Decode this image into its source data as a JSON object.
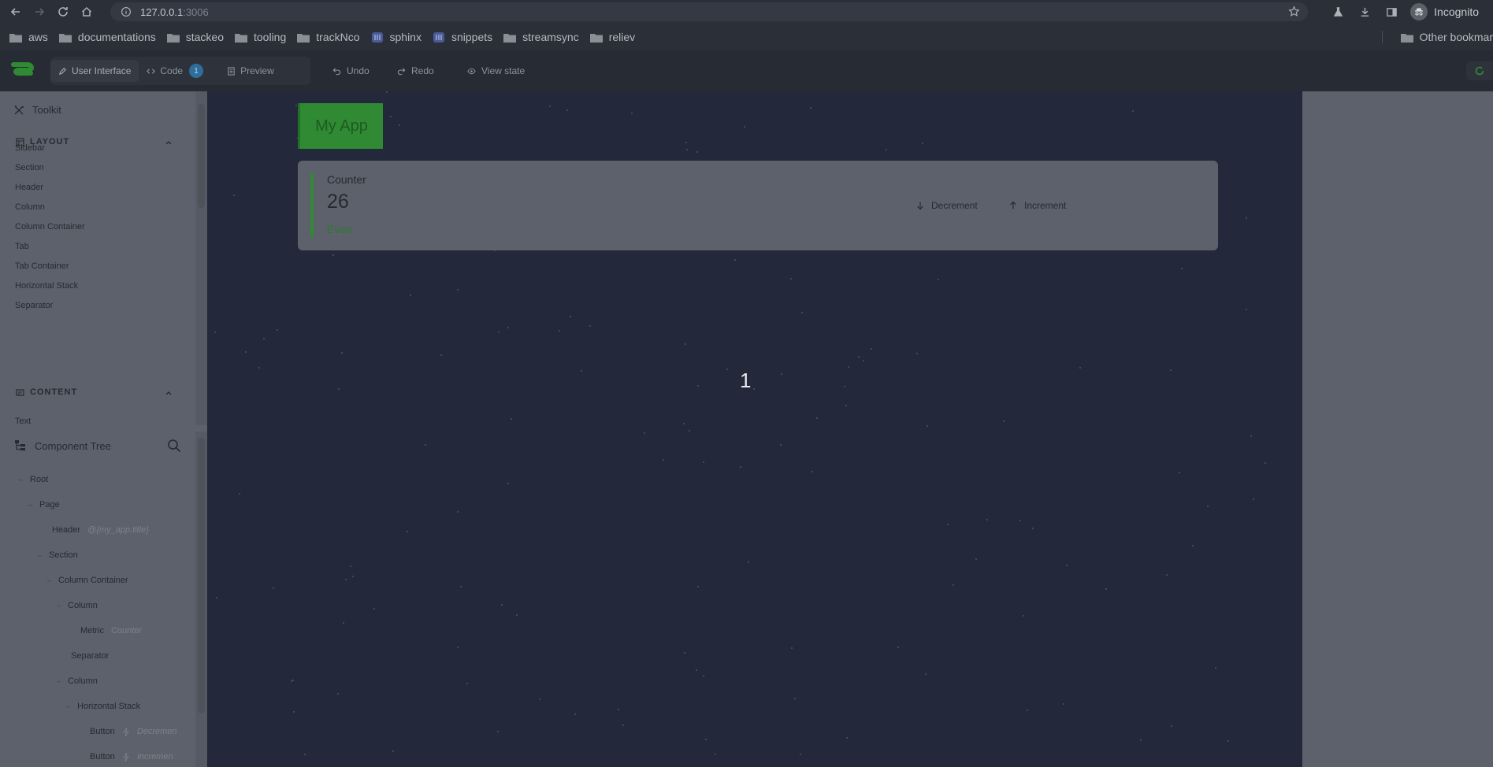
{
  "browser": {
    "url_host": "127.0.0.1",
    "url_port": ":3006",
    "profile_label": "Incognito",
    "bookmarks": [
      {
        "label": "aws",
        "kind": "folder"
      },
      {
        "label": "documentations",
        "kind": "folder"
      },
      {
        "label": "stackeo",
        "kind": "folder"
      },
      {
        "label": "tooling",
        "kind": "folder"
      },
      {
        "label": "trackNco",
        "kind": "folder"
      },
      {
        "label": "sphinx",
        "kind": "site"
      },
      {
        "label": "snippets",
        "kind": "site"
      },
      {
        "label": "streamsync",
        "kind": "folder"
      },
      {
        "label": "reliev",
        "kind": "folder"
      }
    ],
    "other_bookmarks": "Other bookmar"
  },
  "toolbar": {
    "ui_tab": "User Interface",
    "code_tab": "Code",
    "code_badge": "1",
    "preview_tab": "Preview",
    "undo": "Undo",
    "redo": "Redo",
    "view_state": "View state"
  },
  "sidebar": {
    "toolkit_title": "Toolkit",
    "layout_header": "LAYOUT",
    "layout_items": [
      "Sidebar",
      "Section",
      "Header",
      "Column",
      "Column Container",
      "Tab",
      "Tab Container",
      "Horizontal Stack",
      "Separator"
    ],
    "content_header": "CONTENT",
    "content_items": [
      "Text"
    ],
    "tree_title": "Component Tree",
    "tree": [
      {
        "label": "Root",
        "hint": ""
      },
      {
        "label": "Page",
        "hint": ""
      },
      {
        "label": "Header",
        "hint": "@{my_app.title}"
      },
      {
        "label": "Section",
        "hint": ""
      },
      {
        "label": "Column Container",
        "hint": ""
      },
      {
        "label": "Column",
        "hint": ""
      },
      {
        "label": "Metric",
        "hint": "Counter"
      },
      {
        "label": "Separator",
        "hint": ""
      },
      {
        "label": "Column",
        "hint": ""
      },
      {
        "label": "Horizontal Stack",
        "hint": ""
      },
      {
        "label": "Button",
        "hint": "Decremen"
      },
      {
        "label": "Button",
        "hint": "Incremen"
      }
    ]
  },
  "canvas": {
    "app_title": "My App",
    "metric": {
      "label": "Counter",
      "value": "26",
      "note": "Even"
    },
    "decrement_label": "Decrement",
    "increment_label": "Increment",
    "overlay_number": "1"
  },
  "colors": {
    "accent_green": "#2f8a33",
    "canvas_bg": "#23283a",
    "panel_bg": "#5c616b",
    "badge_blue": "#2f6e9c"
  }
}
